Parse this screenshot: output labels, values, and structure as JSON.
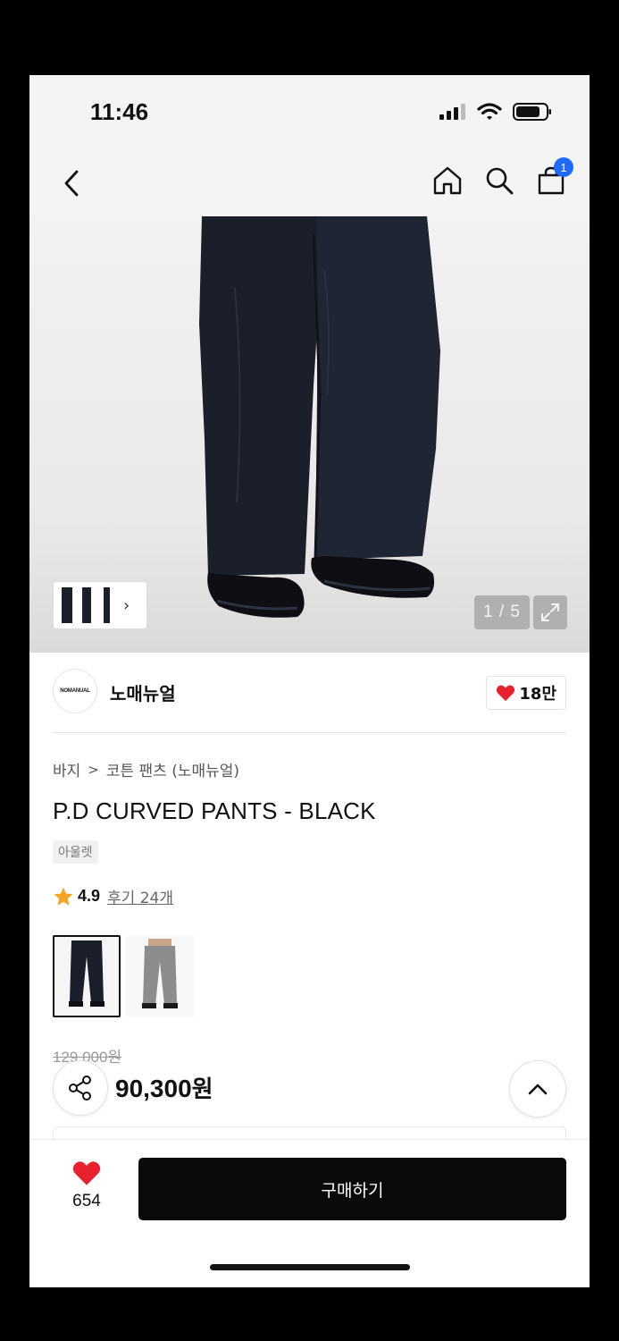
{
  "status_bar": {
    "time": "11:46"
  },
  "nav": {
    "cart_count": "1"
  },
  "gallery": {
    "counter": "1 / 5"
  },
  "brand": {
    "logo_text": "NOMANUAL",
    "name": "노매뉴얼",
    "likes": "18만"
  },
  "product": {
    "breadcrumb": [
      "바지",
      "코튼 팬츠 (노매뉴얼)"
    ],
    "title": "P.D CURVED PANTS - BLACK",
    "tag": "아울렛",
    "rating": "4.9",
    "reviews": "후기 24개",
    "variants": [
      "black",
      "grey"
    ],
    "original_price": "129,000원",
    "sale_price_number": "90,300",
    "sale_price_unit": "원"
  },
  "bottom_bar": {
    "like_count": "654",
    "buy_label": "구매하기"
  },
  "colors": {
    "accent_badge": "#1f6bff",
    "heart": "#e8212f",
    "star": "#f5a623",
    "buy_button": "#0a0a0a"
  }
}
